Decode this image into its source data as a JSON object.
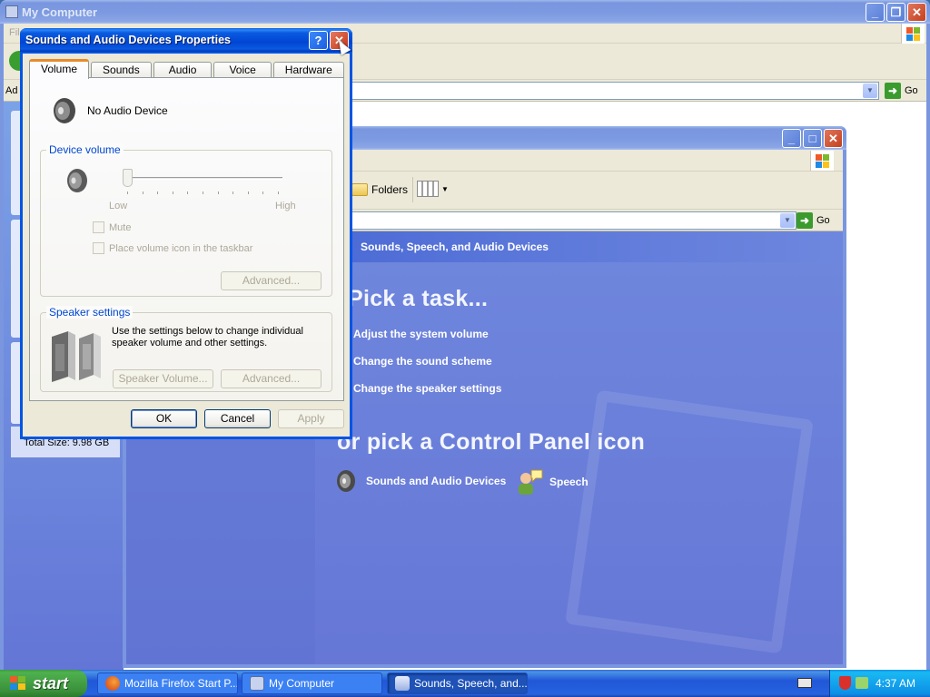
{
  "my_computer": {
    "title": "My Computer",
    "menu": [
      "File"
    ],
    "address_label": "Address",
    "go_label": "Go",
    "details_text": "Total Size: 9.98 GB"
  },
  "sounds_window": {
    "toolbar": {
      "folders_label": "Folders"
    },
    "go_label": "Go",
    "category_title": "Sounds, Speech, and Audio Devices",
    "pick_task_heading": "Pick a task...",
    "tasks": [
      "Adjust the system volume",
      "Change the sound scheme",
      "Change the speaker settings"
    ],
    "pick_icon_heading": "or pick a Control Panel icon",
    "icons": [
      {
        "label": "Sounds and Audio Devices",
        "icon": "speaker-icon"
      },
      {
        "label": "Speech",
        "icon": "speech-icon"
      }
    ]
  },
  "dialog": {
    "title": "Sounds and Audio Devices Properties",
    "tabs": [
      "Volume",
      "Sounds",
      "Audio",
      "Voice",
      "Hardware"
    ],
    "selected_tab": "Volume",
    "device_name": "No Audio Device",
    "device_volume": {
      "label": "Device volume",
      "low_label": "Low",
      "high_label": "High",
      "level": 0,
      "mute_label": "Mute",
      "place_icon_label": "Place volume icon in the taskbar",
      "advanced_label": "Advanced..."
    },
    "speaker_settings": {
      "label": "Speaker settings",
      "description": "Use the settings below to change individual speaker volume and other settings.",
      "speaker_volume_label": "Speaker Volume...",
      "advanced_label": "Advanced..."
    },
    "buttons": {
      "ok": "OK",
      "cancel": "Cancel",
      "apply": "Apply"
    }
  },
  "taskbar": {
    "start_label": "start",
    "items": [
      {
        "label": "Mozilla Firefox Start P...",
        "active": false
      },
      {
        "label": "My Computer",
        "active": false
      },
      {
        "label": "Sounds, Speech, and...",
        "active": true
      }
    ],
    "clock": "4:37 AM"
  }
}
